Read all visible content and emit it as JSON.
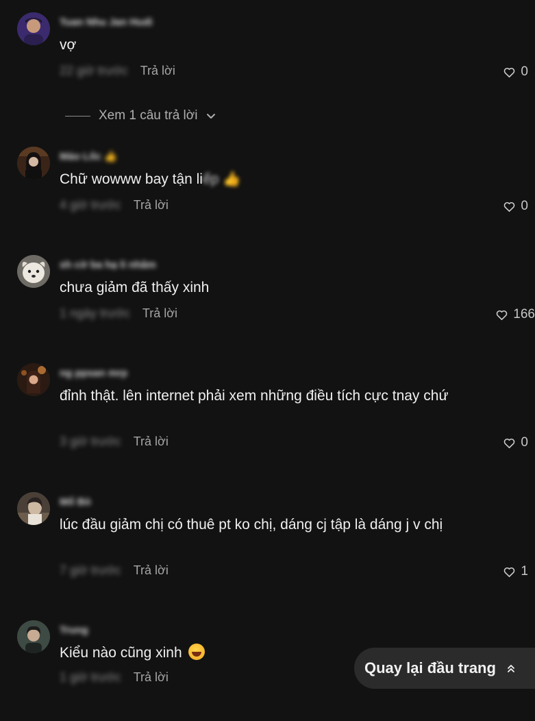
{
  "comments": [
    {
      "username": "Tuan Nhu Jan Hudi",
      "text": "vợ",
      "time": "22 giờ trước",
      "reply_label": "Trả lời",
      "likes": "0",
      "view_replies": "Xem 1 câu trả lời"
    },
    {
      "username": "Mảo Lốc",
      "text": "Chữ wowww bay tận li",
      "text_hidden": "ếp",
      "time": "4 giờ trước",
      "reply_label": "Trả lời",
      "likes": "0"
    },
    {
      "username": "sh cờ ba hạ li nhâm",
      "text": "chưa giảm đã thấy xinh",
      "time": "1 ngày trước",
      "reply_label": "Trả lời",
      "likes": "166"
    },
    {
      "username": "ng ppsan mrp",
      "text": "đỉnh thật. lên internet phải xem những điều tích cực tnay chứ",
      "time": "3 giờ trước",
      "reply_label": "Trả lời",
      "likes": "0"
    },
    {
      "username": "Mổ Bò",
      "text": "lúc đầu giảm chị có thuê pt ko chị, dáng cj tập là dáng j v chị",
      "time": "7 giờ trước",
      "reply_label": "Trả lời",
      "likes": "1"
    },
    {
      "username": "Trung",
      "text": "Kiểu nào cũng xinh",
      "time": "1 giờ trước",
      "reply_label": "Trả lời"
    }
  ],
  "back_to_top": "Quay lại đầu trang",
  "icons": {
    "like": "heart-outline-icon",
    "expand": "chevron-down-icon",
    "top": "double-chevron-up-icon"
  }
}
